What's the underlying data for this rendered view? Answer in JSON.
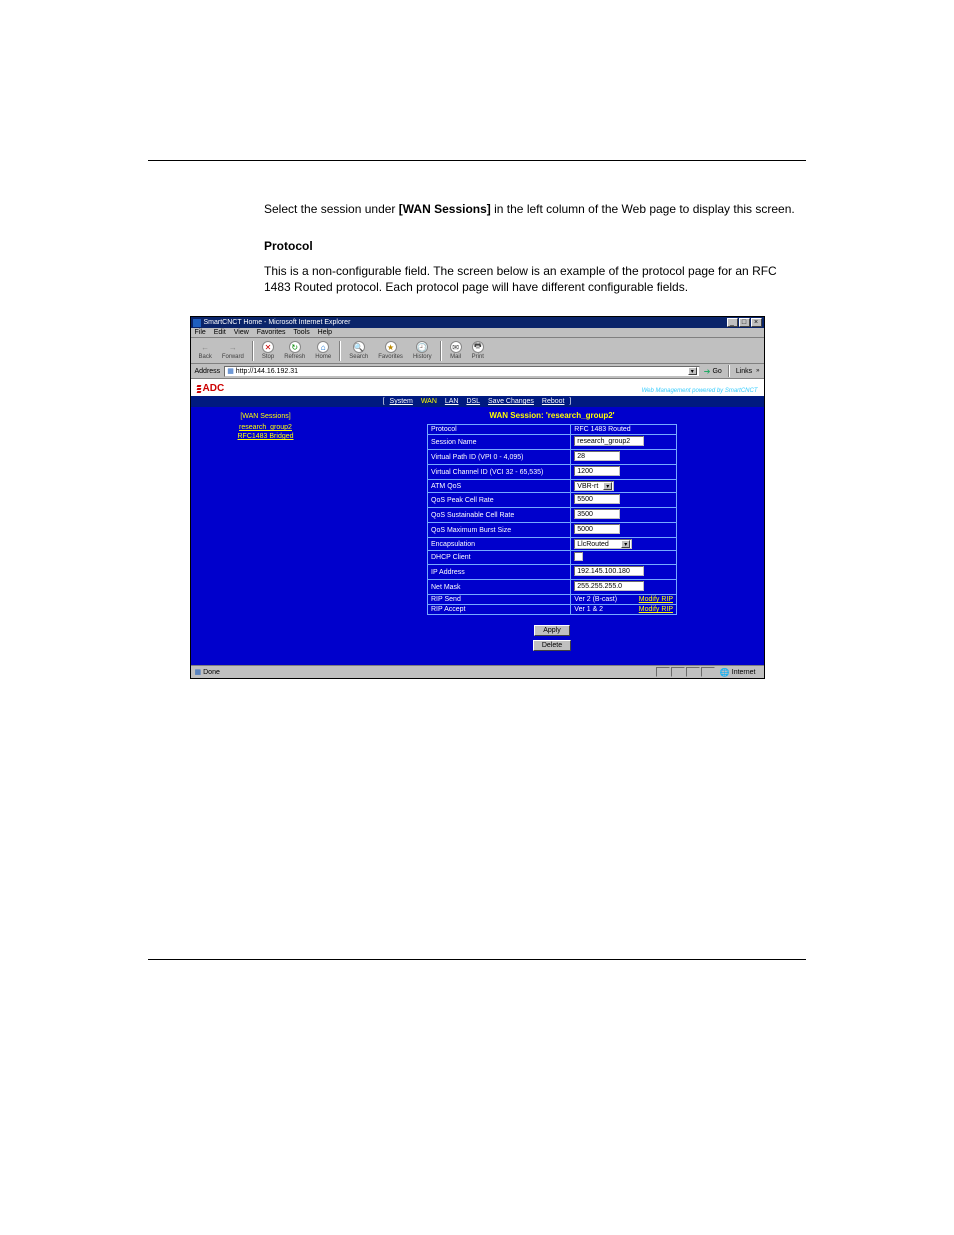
{
  "doc": {
    "line1_prefix": "Select the session under",
    "wan_sessions_bold": "[WAN Sessions]",
    "line1_suffix": "in the left column of the Web page to display this screen.",
    "protocol_heading": "Protocol",
    "protocol_para": "This is a non-configurable field. The screen below is an example of the protocol page for an RFC 1483 Routed protocol. Each protocol page will have different configurable fields."
  },
  "ie": {
    "title": "SmartCNCT Home - Microsoft Internet Explorer",
    "menu": [
      "File",
      "Edit",
      "View",
      "Favorites",
      "Tools",
      "Help"
    ],
    "toolbar": [
      "Back",
      "Forward",
      "Stop",
      "Refresh",
      "Home",
      "Search",
      "Favorites",
      "History",
      "Mail",
      "Print"
    ],
    "address_label": "Address",
    "address_value": "http://144.16.192.31",
    "go_label": "Go",
    "links_label": "Links",
    "status_text": "Done",
    "zone_text": "Internet"
  },
  "app": {
    "logo_text": "ADC",
    "tagline": "Web Management powered by SmartCNCT",
    "nav": [
      "System",
      "WAN",
      "LAN",
      "DSL",
      "Save Changes",
      "Reboot"
    ]
  },
  "sidebar": {
    "heading": "[WAN Sessions]",
    "items": [
      "research_group2",
      "RFC1483 Bridged"
    ]
  },
  "main": {
    "title": "WAN Session: 'research_group2'",
    "rows": [
      {
        "label": "Protocol",
        "value": "RFC 1483 Routed"
      },
      {
        "label": "Session Name",
        "value": "research_group2"
      },
      {
        "label": "Virtual Path ID (VPI 0 - 4,095)",
        "value": "28"
      },
      {
        "label": "Virtual Channel ID (VCI 32 - 65,535)",
        "value": "1200"
      },
      {
        "label": "ATM QoS",
        "value": "VBR-rt"
      },
      {
        "label": "QoS Peak Cell Rate",
        "value": "5500"
      },
      {
        "label": "QoS Sustainable Cell Rate",
        "value": "3500"
      },
      {
        "label": "QoS Maximum Burst Size",
        "value": "5000"
      },
      {
        "label": "Encapsulation",
        "value": "LlcRouted"
      },
      {
        "label": "DHCP Client",
        "value": ""
      },
      {
        "label": "IP Address",
        "value": "192.145.100.180"
      },
      {
        "label": "Net Mask",
        "value": "255.255.255.0"
      },
      {
        "label": "RIP Send",
        "value": "Ver 2 (B-cast)",
        "link": "Modify RIP"
      },
      {
        "label": "RIP Accept",
        "value": "Ver 1 & 2",
        "link": "Modify RIP"
      }
    ],
    "buttons": [
      "Apply",
      "Delete"
    ]
  }
}
